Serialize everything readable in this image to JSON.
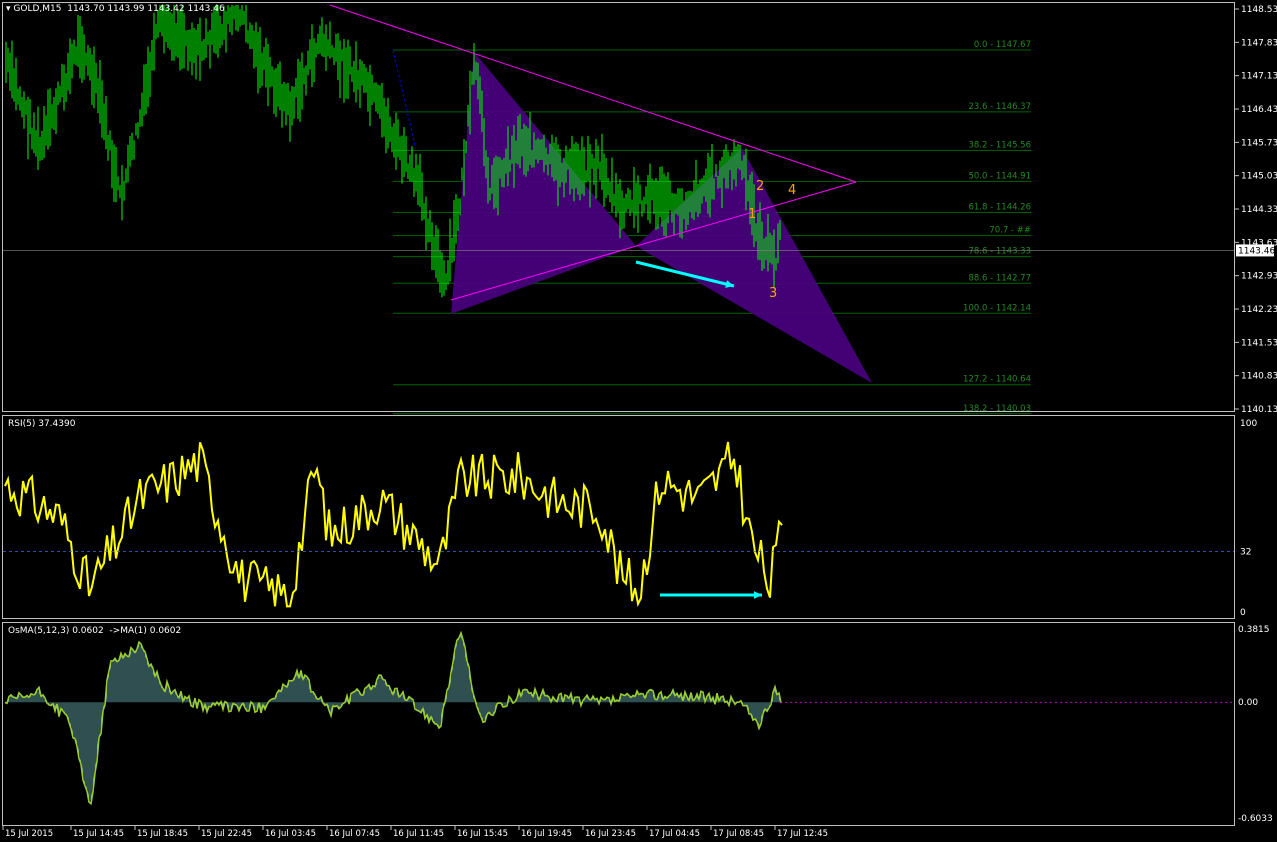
{
  "window": {
    "symbol_label": "GOLD,M15",
    "ohlc_label": "1143.70 1143.99 1143.42 1143.46",
    "current_price_tag": "1143.46",
    "colors": {
      "background": "#000000",
      "grid": "#c0c0c0",
      "candle": "#00ff00",
      "pattern": "#4b0082",
      "trendline": "#ff00ff",
      "fib": "#006400",
      "rsi": "#ffff00",
      "osma": "#9acd32",
      "arrow": "#00ffff",
      "labels": "#ffa500"
    }
  },
  "price_axis": {
    "ticks": [
      "1148.53",
      "1147.83",
      "1147.13",
      "1146.43",
      "1145.73",
      "1145.03",
      "1144.33",
      "1143.63",
      "1142.93",
      "1142.23",
      "1141.53",
      "1140.83",
      "1140.13"
    ]
  },
  "fibonacci": {
    "levels": [
      {
        "label": "0.0 - 1147.67",
        "price": 1147.67
      },
      {
        "label": "23.6 - 1146.37",
        "price": 1146.37
      },
      {
        "label": "38.2 - 1145.56",
        "price": 1145.56
      },
      {
        "label": "50.0 - 1144.91",
        "price": 1144.91
      },
      {
        "label": "61.8 - 1144.26",
        "price": 1144.26
      },
      {
        "label": "70.7 - ##",
        "price": 1143.77
      },
      {
        "label": "78.6 - 1143.33",
        "price": 1143.33
      },
      {
        "label": "88.6 - 1142.77",
        "price": 1142.77
      },
      {
        "label": "100.0 - 1142.14",
        "price": 1142.14
      },
      {
        "label": "127.2 - 1140.64",
        "price": 1140.64
      },
      {
        "label": "138.2 - 1140.03",
        "price": 1140.03
      }
    ]
  },
  "wave_labels": [
    "1",
    "2",
    "3",
    "4"
  ],
  "rsi": {
    "title": "RSI(5) 37.4390",
    "ticks": [
      "100",
      "32",
      "0"
    ],
    "level": 32
  },
  "osma": {
    "title": "OsMA(5,12,3) 0.0602  ->MA(1) 0.0602",
    "ticks": [
      "0.3815",
      "0.00",
      "-0.6033"
    ],
    "max": 0.3815,
    "min": -0.6033
  },
  "time_axis": {
    "labels": [
      "15 Jul 2015",
      "15 Jul 14:45",
      "15 Jul 18:45",
      "15 Jul 22:45",
      "16 Jul 03:45",
      "16 Jul 07:45",
      "16 Jul 11:45",
      "16 Jul 15:45",
      "16 Jul 19:45",
      "16 Jul 23:45",
      "17 Jul 04:45",
      "17 Jul 08:45",
      "17 Jul 12:45"
    ]
  }
}
